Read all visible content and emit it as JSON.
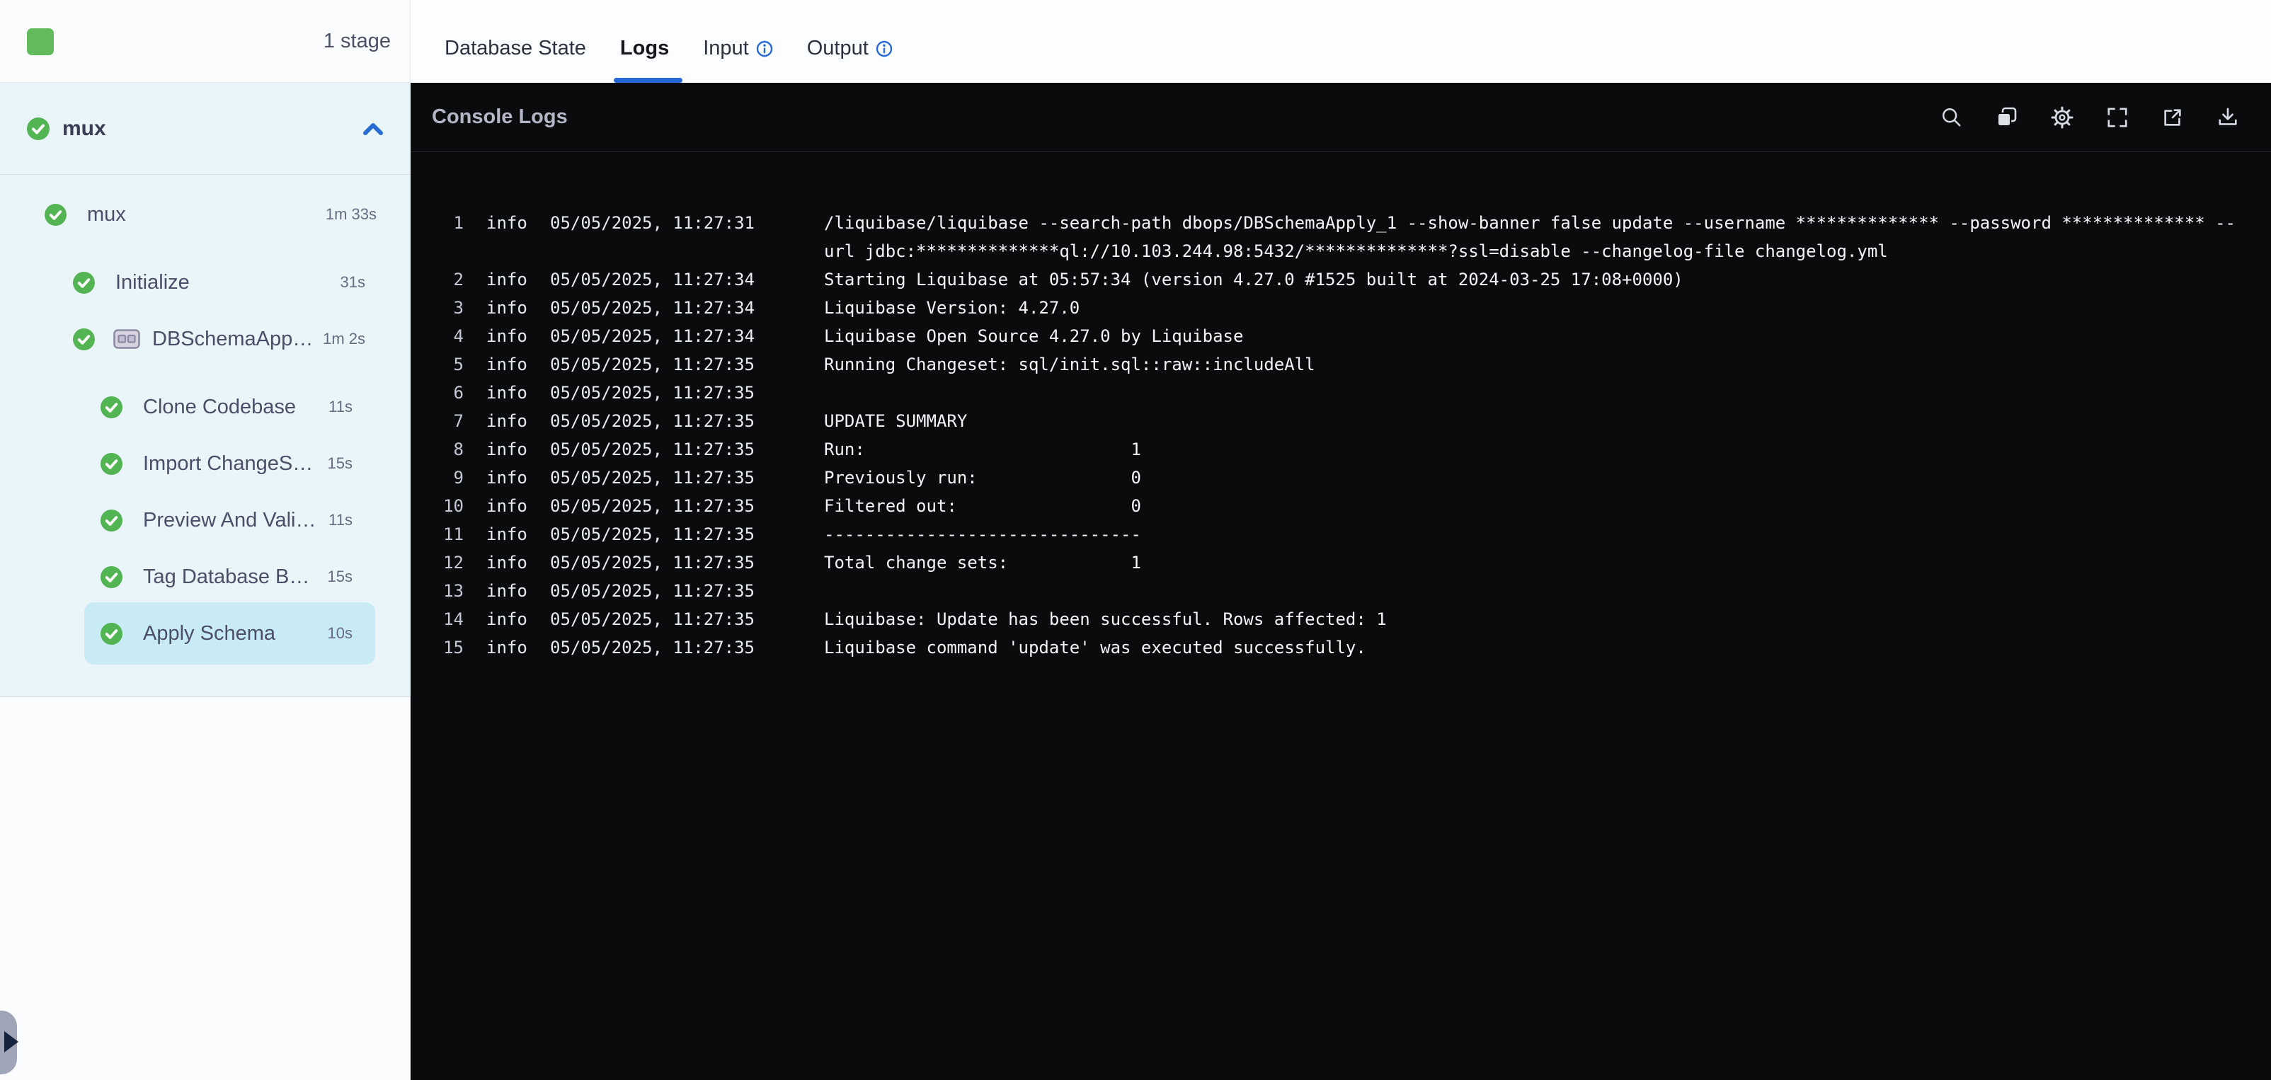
{
  "sidebar": {
    "stage_count": "1 stage",
    "group": {
      "label": "mux"
    },
    "tree": [
      {
        "label": "mux",
        "duration": "1m 33s"
      },
      {
        "label": "Initialize",
        "duration": "31s"
      },
      {
        "label": "DBSchemaApp…",
        "duration": "1m 2s"
      },
      {
        "label": "Clone Codebase",
        "duration": "11s"
      },
      {
        "label": "Import ChangeS…",
        "duration": "15s"
      },
      {
        "label": "Preview And Vali…",
        "duration": "11s"
      },
      {
        "label": "Tag Database B…",
        "duration": "15s"
      },
      {
        "label": "Apply Schema",
        "duration": "10s"
      }
    ]
  },
  "tabs": {
    "database_state": "Database State",
    "logs": "Logs",
    "input": "Input",
    "output": "Output"
  },
  "console": {
    "title": "Console Logs",
    "toolbar_icons": [
      "search",
      "copy",
      "settings",
      "fullscreen",
      "open-in-new",
      "download"
    ],
    "logs": [
      {
        "n": "1",
        "lvl": "info",
        "time": "05/05/2025, 11:27:31",
        "msg": "/liquibase/liquibase --search-path dbops/DBSchemaApply_1 --show-banner false update --username ************** --password ************** --\nurl jdbc:**************ql://10.103.244.98:5432/**************?ssl=disable --changelog-file changelog.yml"
      },
      {
        "n": "2",
        "lvl": "info",
        "time": "05/05/2025, 11:27:34",
        "msg": "Starting Liquibase at 05:57:34 (version 4.27.0 #1525 built at 2024-03-25 17:08+0000)"
      },
      {
        "n": "3",
        "lvl": "info",
        "time": "05/05/2025, 11:27:34",
        "msg": "Liquibase Version: 4.27.0"
      },
      {
        "n": "4",
        "lvl": "info",
        "time": "05/05/2025, 11:27:34",
        "msg": "Liquibase Open Source 4.27.0 by Liquibase"
      },
      {
        "n": "5",
        "lvl": "info",
        "time": "05/05/2025, 11:27:35",
        "msg": "Running Changeset: sql/init.sql::raw::includeAll"
      },
      {
        "n": "6",
        "lvl": "info",
        "time": "05/05/2025, 11:27:35",
        "msg": ""
      },
      {
        "n": "7",
        "lvl": "info",
        "time": "05/05/2025, 11:27:35",
        "msg": "UPDATE SUMMARY"
      },
      {
        "n": "8",
        "lvl": "info",
        "time": "05/05/2025, 11:27:35",
        "msg": "Run:                          1"
      },
      {
        "n": "9",
        "lvl": "info",
        "time": "05/05/2025, 11:27:35",
        "msg": "Previously run:               0"
      },
      {
        "n": "10",
        "lvl": "info",
        "time": "05/05/2025, 11:27:35",
        "msg": "Filtered out:                 0"
      },
      {
        "n": "11",
        "lvl": "info",
        "time": "05/05/2025, 11:27:35",
        "msg": "-------------------------------"
      },
      {
        "n": "12",
        "lvl": "info",
        "time": "05/05/2025, 11:27:35",
        "msg": "Total change sets:            1"
      },
      {
        "n": "13",
        "lvl": "info",
        "time": "05/05/2025, 11:27:35",
        "msg": ""
      },
      {
        "n": "14",
        "lvl": "info",
        "time": "05/05/2025, 11:27:35",
        "msg": "Liquibase: Update has been successful. Rows affected: 1"
      },
      {
        "n": "15",
        "lvl": "info",
        "time": "05/05/2025, 11:27:35",
        "msg": "Liquibase command 'update' was executed successfully."
      }
    ]
  },
  "colors": {
    "success_green": "#53b453",
    "stage_square_green": "#62ba5c",
    "accent_blue": "#2368d6",
    "selected_row": "#c9ebf6",
    "console_bg": "#0a0b0d",
    "panel_cyan": "#e9f5f8"
  }
}
